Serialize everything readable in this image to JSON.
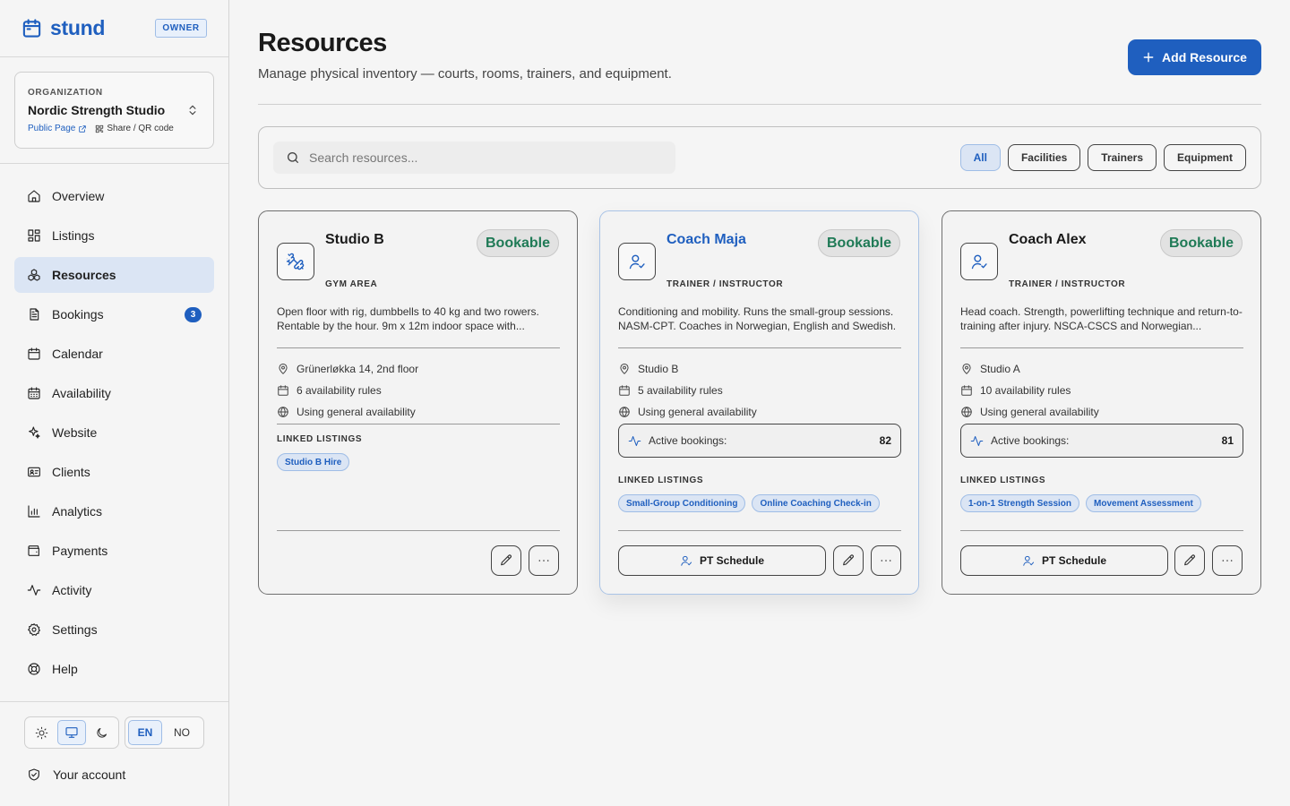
{
  "app": {
    "name": "stund",
    "role_badge": "OWNER"
  },
  "org": {
    "label": "ORGANIZATION",
    "name": "Nordic Strength Studio",
    "public_link": "Public Page",
    "share_link": "Share / QR code"
  },
  "nav": {
    "items": [
      {
        "label": "Overview",
        "icon": "home-icon"
      },
      {
        "label": "Listings",
        "icon": "grid-icon"
      },
      {
        "label": "Resources",
        "icon": "boxes-icon",
        "active": true
      },
      {
        "label": "Bookings",
        "icon": "clipboard-icon",
        "badge": "3"
      },
      {
        "label": "Calendar",
        "icon": "calendar-icon"
      },
      {
        "label": "Availability",
        "icon": "calendar-grid-icon"
      },
      {
        "label": "Website",
        "icon": "sparkles-icon"
      },
      {
        "label": "Clients",
        "icon": "id-card-icon"
      },
      {
        "label": "Analytics",
        "icon": "bar-chart-icon"
      },
      {
        "label": "Payments",
        "icon": "wallet-icon"
      },
      {
        "label": "Activity",
        "icon": "activity-icon"
      },
      {
        "label": "Settings",
        "icon": "gear-icon"
      },
      {
        "label": "Help",
        "icon": "lifebuoy-icon"
      }
    ]
  },
  "lang": {
    "en": "EN",
    "no": "NO"
  },
  "account": {
    "label": "Your account"
  },
  "page": {
    "title": "Resources",
    "subtitle": "Manage physical inventory — courts, rooms, trainers, and equipment.",
    "add_button": "Add Resource"
  },
  "filters": {
    "search_placeholder": "Search resources...",
    "chips": [
      "All",
      "Facilities",
      "Trainers",
      "Equipment"
    ],
    "active": "All"
  },
  "common": {
    "linked_label": "LINKED LISTINGS",
    "active_bookings_label": "Active bookings:",
    "status": "Bookable",
    "pt_schedule": "PT Schedule"
  },
  "cards": [
    {
      "title": "Studio B",
      "type": "GYM AREA",
      "icon": "dumbbell-icon",
      "description": "Open floor with rig, dumbbells to 40 kg and two rowers. Rentable by the hour. 9m x 12m indoor space with...",
      "location": "Grünerløkka 14, 2nd floor",
      "availability_rules": "6 availability rules",
      "general": "Using general availability",
      "linked": [
        "Studio B Hire"
      ]
    },
    {
      "title": "Coach Maja",
      "type": "TRAINER / INSTRUCTOR",
      "icon": "user-check-icon",
      "description": "Conditioning and mobility. Runs the small-group sessions. NASM-CPT. Coaches in Norwegian, English and Swedish.",
      "location": "Studio B",
      "availability_rules": "5 availability rules",
      "general": "Using general availability",
      "active_bookings": "82",
      "linked": [
        "Small-Group Conditioning",
        "Online Coaching Check-in"
      ]
    },
    {
      "title": "Coach Alex",
      "type": "TRAINER / INSTRUCTOR",
      "icon": "user-check-icon",
      "description": "Head coach. Strength, powerlifting technique and return-to-training after injury. NSCA-CSCS and Norwegian...",
      "location": "Studio A",
      "availability_rules": "10 availability rules",
      "general": "Using general availability",
      "active_bookings": "81",
      "linked": [
        "1-on-1 Strength Session",
        "Movement Assessment"
      ]
    }
  ]
}
